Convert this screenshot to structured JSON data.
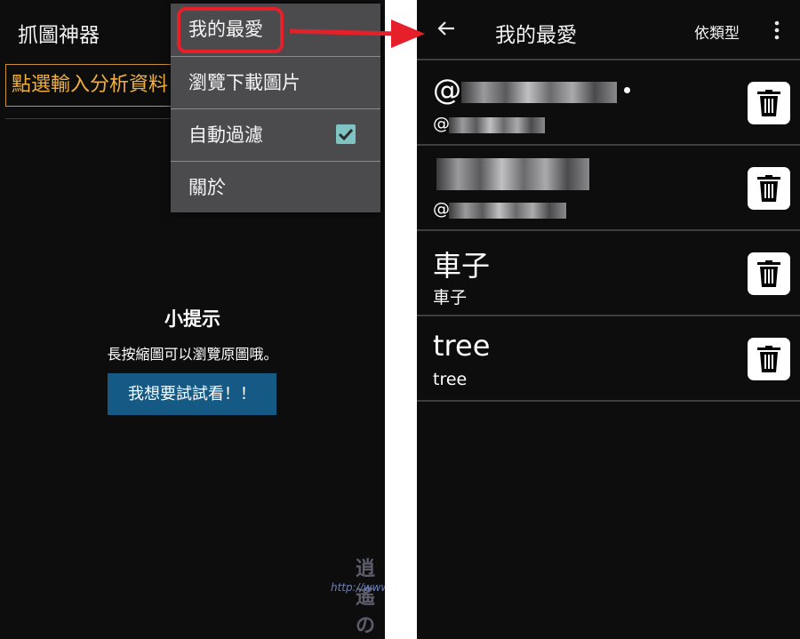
{
  "left_screen": {
    "app_title": "抓圖神器",
    "url_input": {
      "placeholder": "點選輸入分析資料"
    },
    "menu": {
      "items": [
        {
          "label": "我的最愛"
        },
        {
          "label": "瀏覽下載圖片"
        },
        {
          "label": "自動過濾",
          "checked": true
        },
        {
          "label": "關於"
        }
      ]
    },
    "tip": {
      "title": "小提示",
      "text": "長按縮圖可以瀏覽原圖哦。",
      "button": "我想要試試看！！"
    }
  },
  "right_screen": {
    "title": "我的最愛",
    "sort_label": "依類型",
    "favorites": [
      {
        "name": "@",
        "sub": "@",
        "blurred": true
      },
      {
        "name": "",
        "sub": "@",
        "blurred": true
      },
      {
        "name": "車子",
        "sub": "車子"
      },
      {
        "name": "tree",
        "sub": "tree"
      }
    ]
  },
  "watermark": {
    "logo": "逍遙の窩",
    "url": "http://www.xiaoyao.tw/"
  },
  "colors": {
    "background": "#0d0d0e",
    "menu": "#4b4b4d",
    "accent_orange": "#f0b040",
    "highlight_red": "#e6202a",
    "button_blue": "#155a85",
    "checkbox_teal": "#7fc3c2"
  }
}
